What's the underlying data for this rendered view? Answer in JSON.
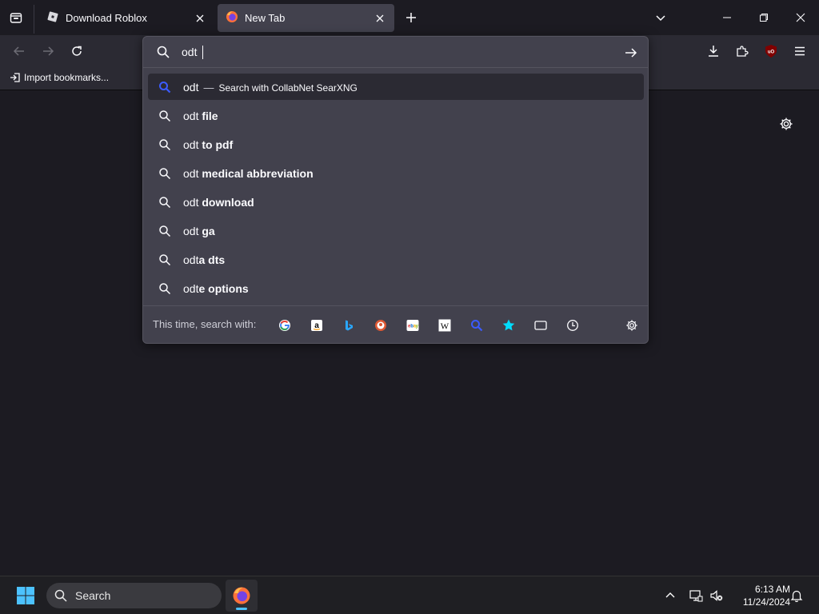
{
  "tabs": [
    {
      "label": "Download Roblox",
      "icon": "roblox-icon"
    },
    {
      "label": "New Tab",
      "icon": "firefox-icon"
    }
  ],
  "bookmarks": {
    "import_label": "Import bookmarks..."
  },
  "urlbar": {
    "value": "odt ",
    "placeholder": ""
  },
  "suggestions": {
    "primary": {
      "query": "odt",
      "dash": "—",
      "engine_text": "Search with CollabNet SearXNG"
    },
    "items": [
      {
        "prefix": "odt ",
        "bold": "file"
      },
      {
        "prefix": "odt ",
        "bold": "to pdf"
      },
      {
        "prefix": "odt ",
        "bold": "medical abbreviation"
      },
      {
        "prefix": "odt ",
        "bold": "download"
      },
      {
        "prefix": "odt ",
        "bold": "ga"
      },
      {
        "prefix": "odt",
        "bold": "a dts"
      },
      {
        "prefix": "odt",
        "bold": "e options"
      }
    ]
  },
  "oneoff": {
    "label": "This time, search with:",
    "engines": [
      "google-icon",
      "amazon-icon",
      "bing-icon",
      "duckduckgo-icon",
      "ebay-icon",
      "wikipedia-icon",
      "searxng-icon",
      "bookmarks-icon",
      "tabs-icon",
      "history-icon"
    ]
  },
  "taskbar": {
    "search_label": "Search",
    "time": "6:13 AM",
    "date": "11/24/2024"
  },
  "colors": {
    "accent": "#4cc2ff",
    "search_blue": "#3b5bff"
  }
}
